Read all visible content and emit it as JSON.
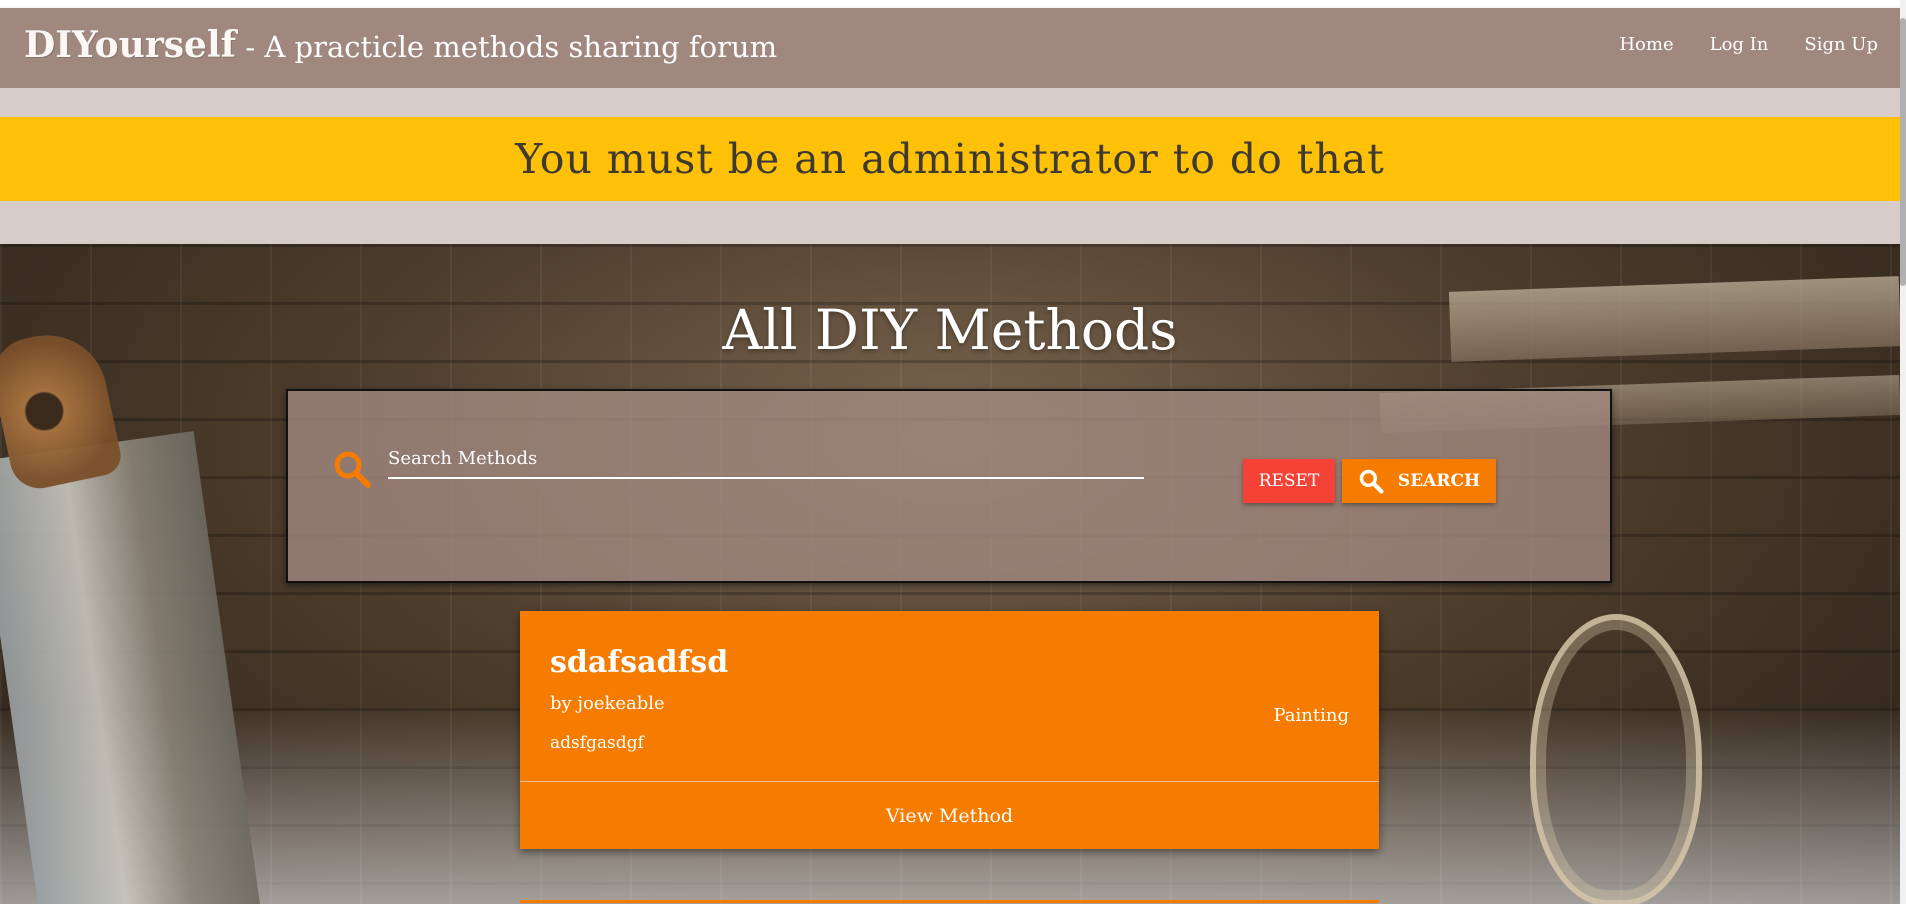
{
  "navbar": {
    "brand_logo": "DIYourself",
    "brand_tagline": " - A practicle methods sharing forum",
    "links": [
      {
        "label": "Home"
      },
      {
        "label": "Log In"
      },
      {
        "label": "Sign Up"
      }
    ]
  },
  "flash": {
    "message": "You must be an administrator to do that",
    "color": "#ffc107"
  },
  "hero": {
    "title": "All DIY Methods"
  },
  "search": {
    "placeholder": "Search Methods",
    "value": "",
    "icon": "search-icon",
    "reset_label": "RESET",
    "search_label": "SEARCH",
    "reset_color": "#f44336",
    "search_color": "#f57c00"
  },
  "methods": [
    {
      "title": "sdafsadfsd",
      "author": "by joekeable",
      "description": "adsfgasdgf",
      "category": "Painting",
      "action_label": "View Method"
    }
  ],
  "colors": {
    "navbar": "#a1887f",
    "accent": "#f57c00",
    "flash_background": "#d7ccc8"
  }
}
